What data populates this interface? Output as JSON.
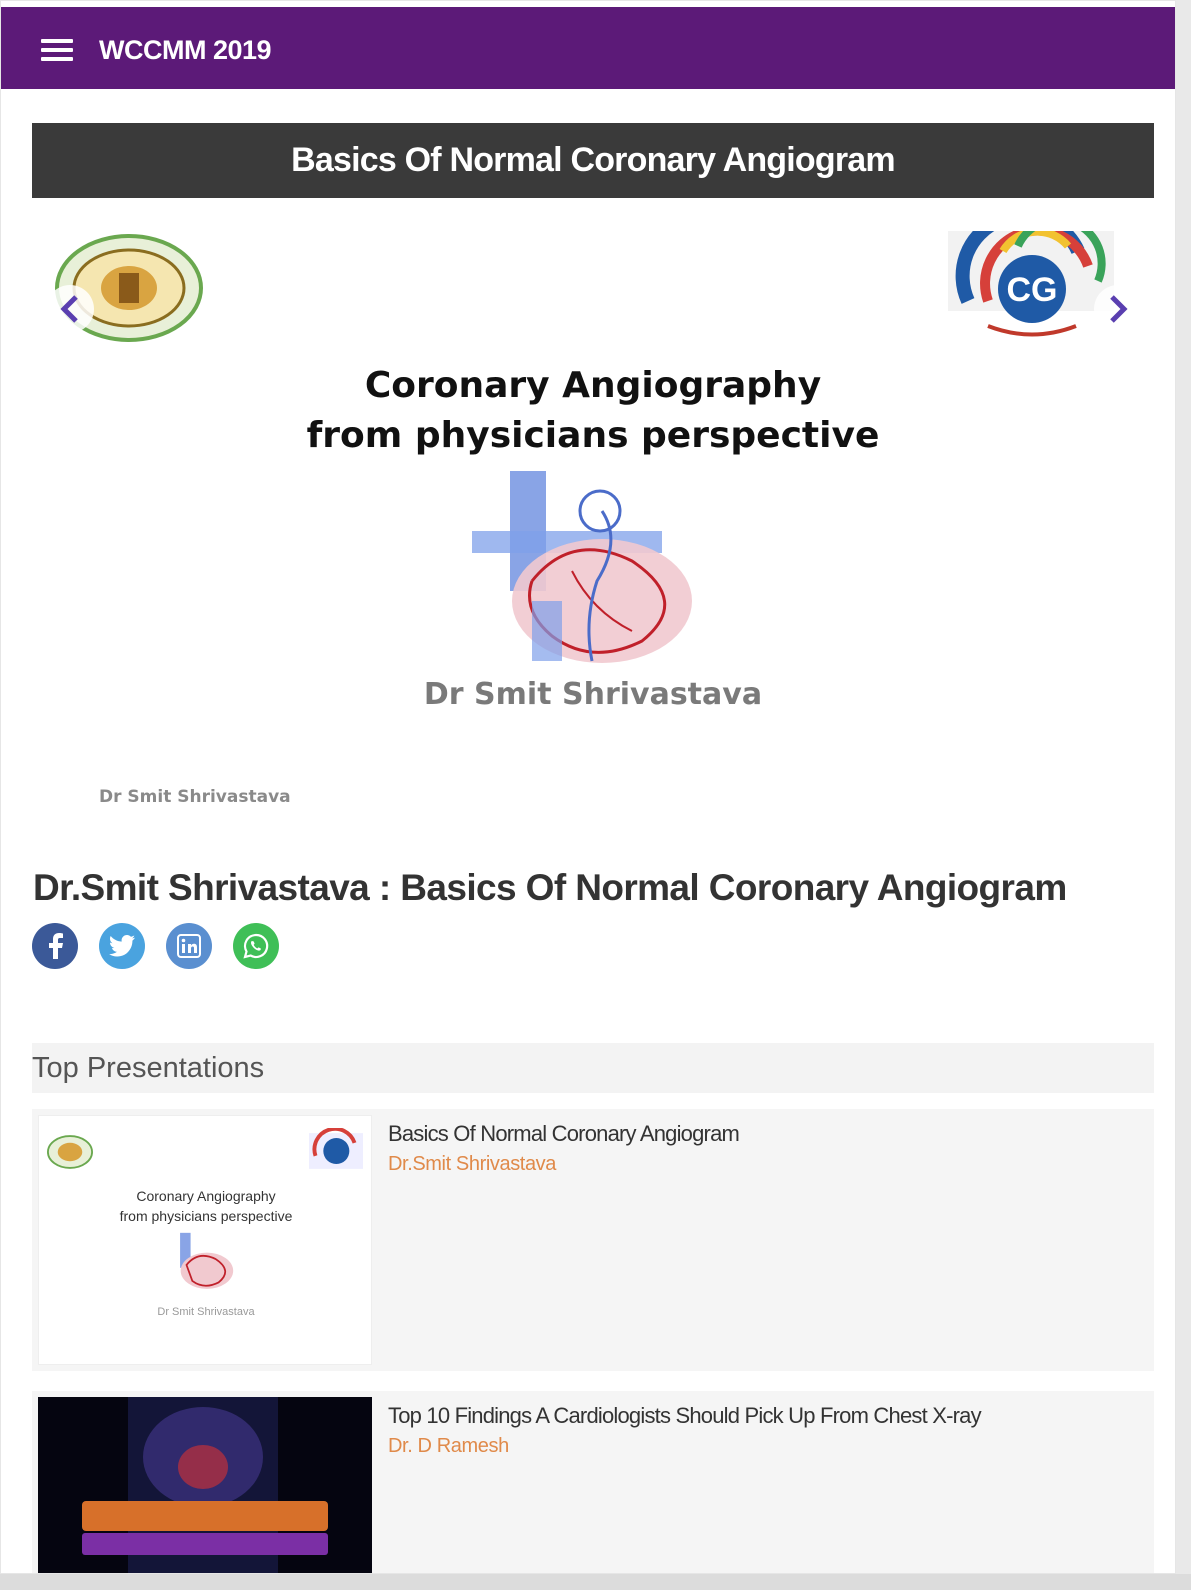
{
  "app": {
    "title": "WCCMM 2019"
  },
  "banner": {
    "title": "Basics Of Normal Coronary Angiogram"
  },
  "slide": {
    "heading_line1": "Coronary Angiography",
    "heading_line2": "from physicians perspective",
    "author": "Dr Smit Shrivastava",
    "footer": "Dr Smit Shrivastava"
  },
  "page": {
    "title": "Dr.Smit Shrivastava : Basics Of Normal Coronary Angiogram"
  },
  "share": [
    {
      "icon": "facebook-icon",
      "color": "#3b5998"
    },
    {
      "icon": "twitter-icon",
      "color": "#4aa3df"
    },
    {
      "icon": "linkedin-icon",
      "color": "#5a8fd0"
    },
    {
      "icon": "whatsapp-icon",
      "color": "#3fbf57"
    }
  ],
  "top_presentations": {
    "heading": "Top Presentations",
    "items": [
      {
        "title": "Basics Of Normal Coronary Angiogram",
        "author": "Dr.Smit Shrivastava",
        "thumb_line1": "Coronary Angiography",
        "thumb_line2": "from physicians perspective",
        "thumb_author": "Dr Smit Shrivastava"
      },
      {
        "title": "Top 10 Findings A Cardiologists Should Pick Up From Chest X-ray",
        "author": "Dr. D Ramesh"
      }
    ]
  },
  "colors": {
    "appbar": "#5c1a78",
    "title_bar": "#3a3a3a",
    "author_accent": "#e08a4a"
  }
}
